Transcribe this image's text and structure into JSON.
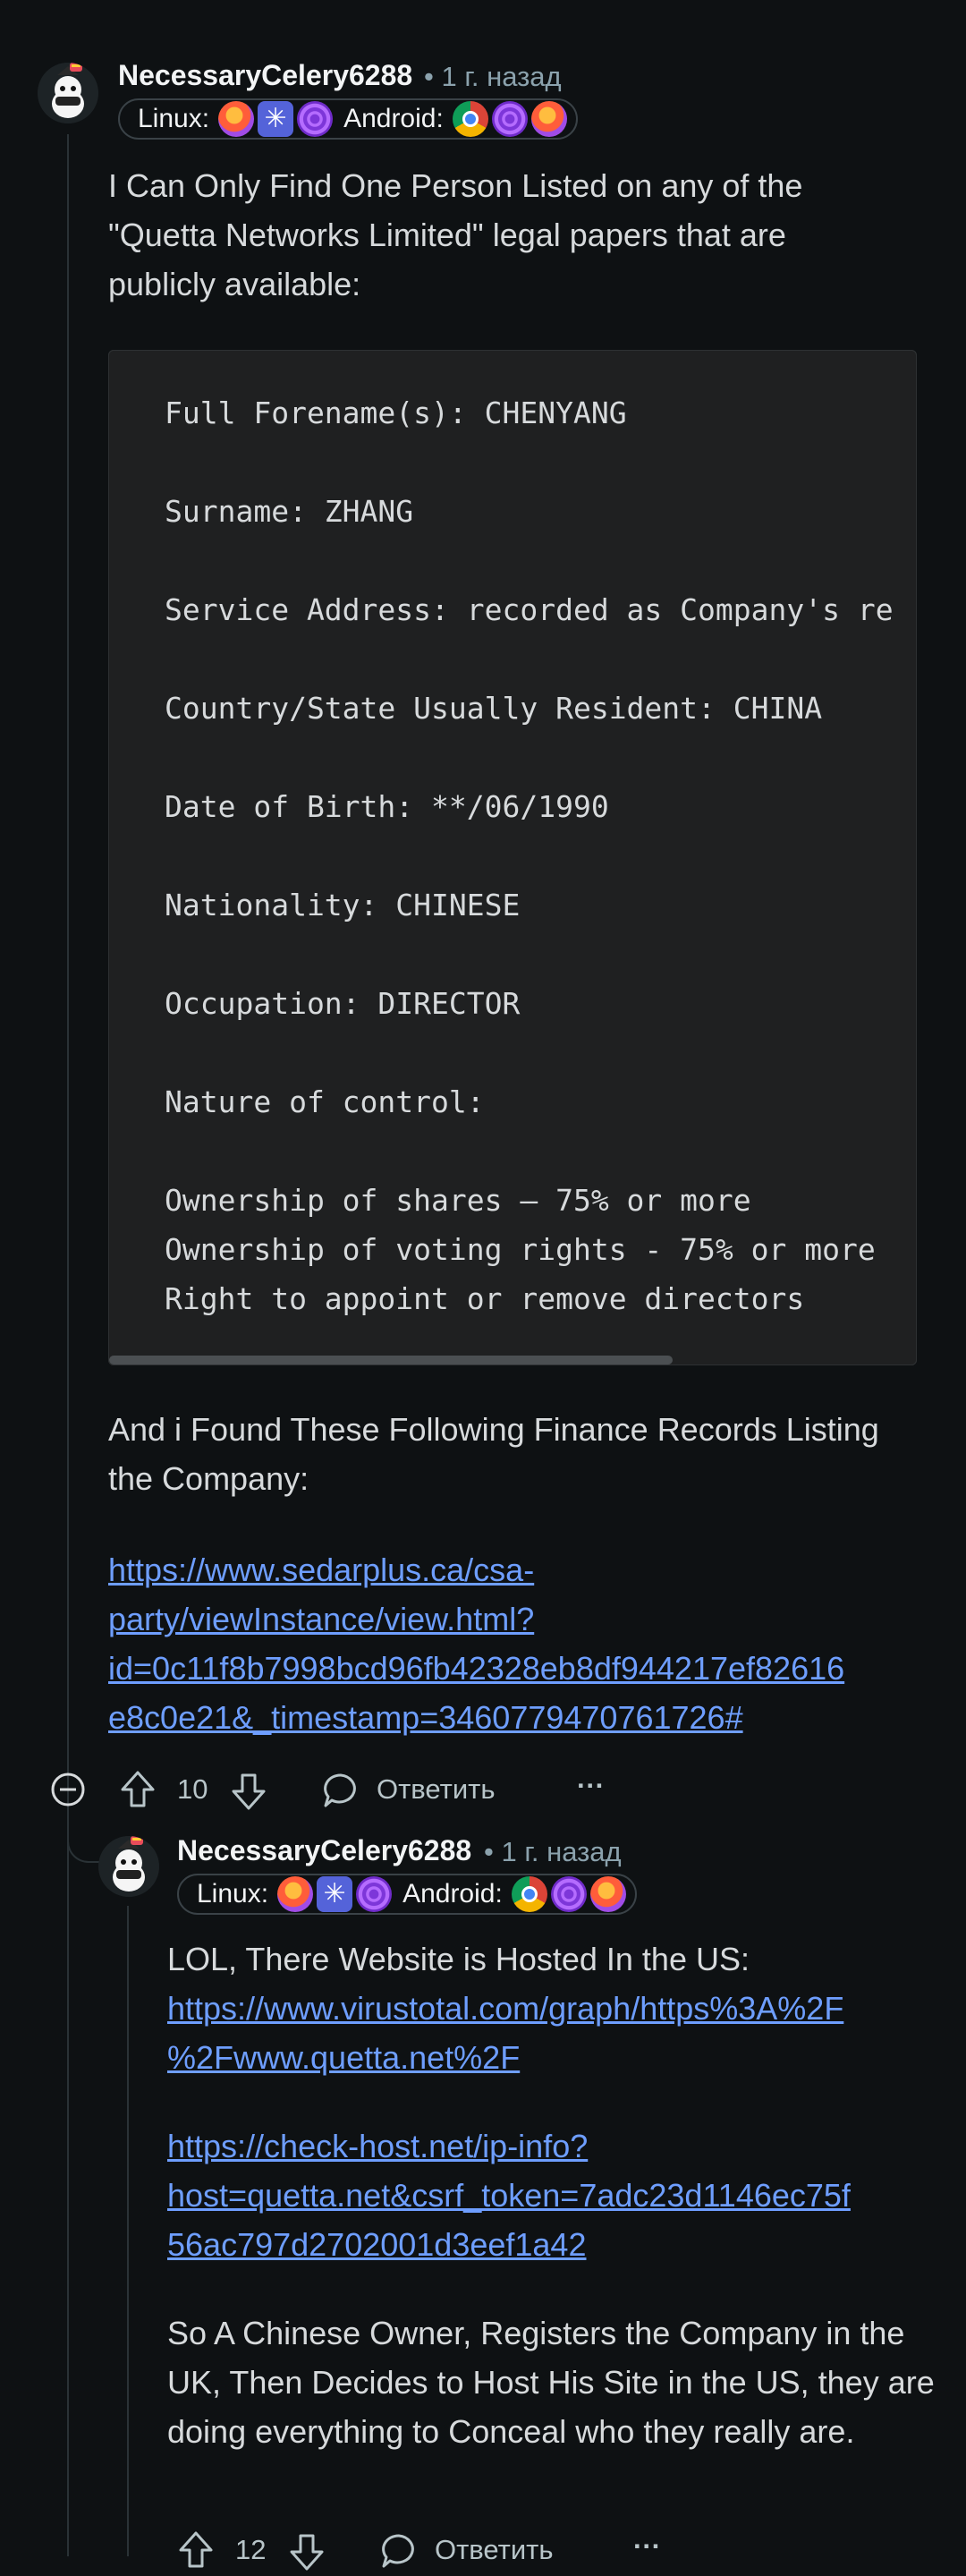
{
  "comment1": {
    "username": "NecessaryCelery6288",
    "time": "• 1 г. назад",
    "flair": {
      "linux": "Linux:",
      "android": "Android:"
    },
    "intro": "I Can Only Find One Person Listed on any of the \"Quetta Networks Limited\" legal papers that are publicly available:",
    "code_lines": [
      "Full Forename(s): CHENYANG",
      "Surname: ZHANG",
      "Service Address: recorded as Company's re",
      "Country/State Usually Resident: CHINA",
      "Date of Birth: **/06/1990",
      "Nationality: CHINESE",
      "Occupation: DIRECTOR",
      "Nature of control:",
      "Ownership of shares – 75% or more",
      "Ownership of voting rights - 75% or more",
      "Right to appoint or remove directors"
    ],
    "finance_text": "And i Found These Following Finance Records Listing the Company:",
    "link_lines": [
      "https://www.sedarplus.ca/csa-",
      "party/viewInstance/view.html?",
      "id=0c11f8b7998bcd96fb42328eb8df944217ef82616",
      "e8c0e21&_timestamp=3460779470761726#"
    ],
    "votes": "10",
    "reply_label": "Ответить",
    "more": "···"
  },
  "comment2": {
    "username": "NecessaryCelery6288",
    "time": "• 1 г. назад",
    "flair": {
      "linux": "Linux:",
      "android": "Android:"
    },
    "intro": "LOL, There Website is Hosted In the US:",
    "link1_lines": [
      "https://www.virustotal.com/graph/https%3A%2F",
      "%2Fwww.quetta.net%2F"
    ],
    "link2_lines": [
      "https://check-host.net/ip-info?",
      "host=quetta.net&csrf_token=7adc23d1146ec75f",
      "56ac797d2702001d3eef1a42"
    ],
    "conclusion": "So A Chinese Owner, Registers the Company in the UK, Then Decides to Host His Site in the US, they are doing everything to Conceal who they really are.",
    "votes": "12",
    "reply_label": "Ответить",
    "more": "···"
  },
  "colors": {
    "background": "#0e1113",
    "text": "#d7dadc",
    "link": "#6e9eff",
    "meta": "#8ba2ad",
    "code_bg": "#1f2021"
  }
}
